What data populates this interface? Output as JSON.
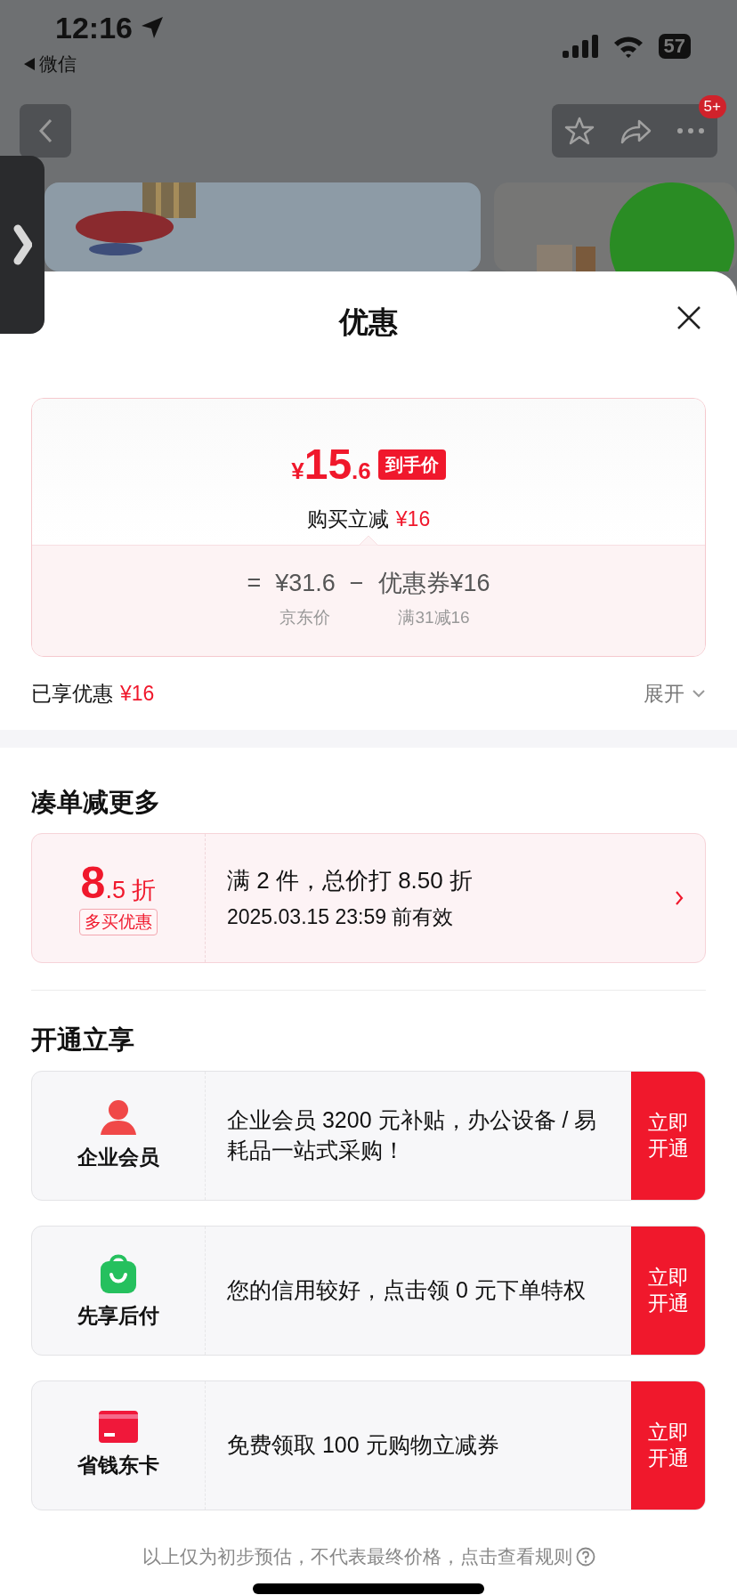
{
  "status_bar": {
    "time": "12:16",
    "back_app": "微信",
    "battery": "57"
  },
  "nav": {
    "badge": "5+"
  },
  "sheet": {
    "title": "优惠",
    "price_card": {
      "currency": "¥",
      "integer": "15",
      "decimal": ".6",
      "tag": "到手价",
      "reduce_label": "购买立减",
      "reduce_amount": "¥16",
      "equals": "=",
      "base_price": "¥31.6",
      "minus": "−",
      "coupon": "优惠券¥16",
      "base_label": "京东价",
      "coupon_note": "满31减16"
    },
    "enjoyed": {
      "label": "已享优惠",
      "amount": "¥16",
      "expand": "展开"
    },
    "bundle": {
      "heading": "凑单减更多",
      "offer": {
        "big": "8",
        "small": ".5 折",
        "tag": "多买优惠",
        "line1": "满 2 件，总价打 8.50 折",
        "line2": "2025.03.15 23:59 前有效"
      }
    },
    "membership": {
      "heading": "开通立享",
      "rows": [
        {
          "kind": "person",
          "name": "企业会员",
          "desc": "企业会员 3200 元补贴，办公设备 / 易耗品一站式采购！",
          "button": "立即开通"
        },
        {
          "kind": "bag",
          "name": "先享后付",
          "desc": "您的信用较好，点击领 0 元下单特权",
          "button": "立即开通"
        },
        {
          "kind": "card",
          "name": "省钱东卡",
          "desc": "免费领取 100 元购物立减券",
          "button": "立即开通"
        }
      ]
    },
    "footer": "以上仅为初步预估，不代表最终价格，点击查看规则"
  }
}
